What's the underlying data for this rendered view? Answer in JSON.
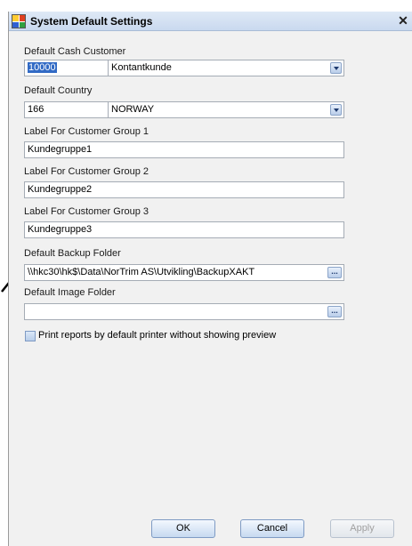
{
  "window": {
    "title": "System Default Settings",
    "close_glyph": "✕"
  },
  "cash_customer": {
    "label": "Default Cash Customer",
    "code": "10000",
    "name": "Kontantkunde"
  },
  "country": {
    "label": "Default Country",
    "code": "166",
    "name": "NORWAY"
  },
  "customer_groups": [
    {
      "label": "Label For Customer Group 1",
      "value": "Kundegruppe1"
    },
    {
      "label": "Label For Customer Group 2",
      "value": "Kundegruppe2"
    },
    {
      "label": "Label For Customer Group 3",
      "value": "Kundegruppe3"
    }
  ],
  "backup_folder": {
    "label": "Default Backup Folder",
    "value": "\\\\hkc30\\hk$\\Data\\NorTrim AS\\Utvikling\\BackupXAKT",
    "browse": "..."
  },
  "image_folder": {
    "label": "Default Image Folder",
    "value": "",
    "browse": "..."
  },
  "print_option": {
    "label": "Print reports by default printer without showing preview",
    "checked": false
  },
  "buttons": {
    "ok": "OK",
    "cancel": "Cancel",
    "apply": "Apply"
  },
  "icons": [
    "app-icon",
    "close-icon",
    "dropdown-icon",
    "browse-icon",
    "pointer-arrow-icon"
  ]
}
